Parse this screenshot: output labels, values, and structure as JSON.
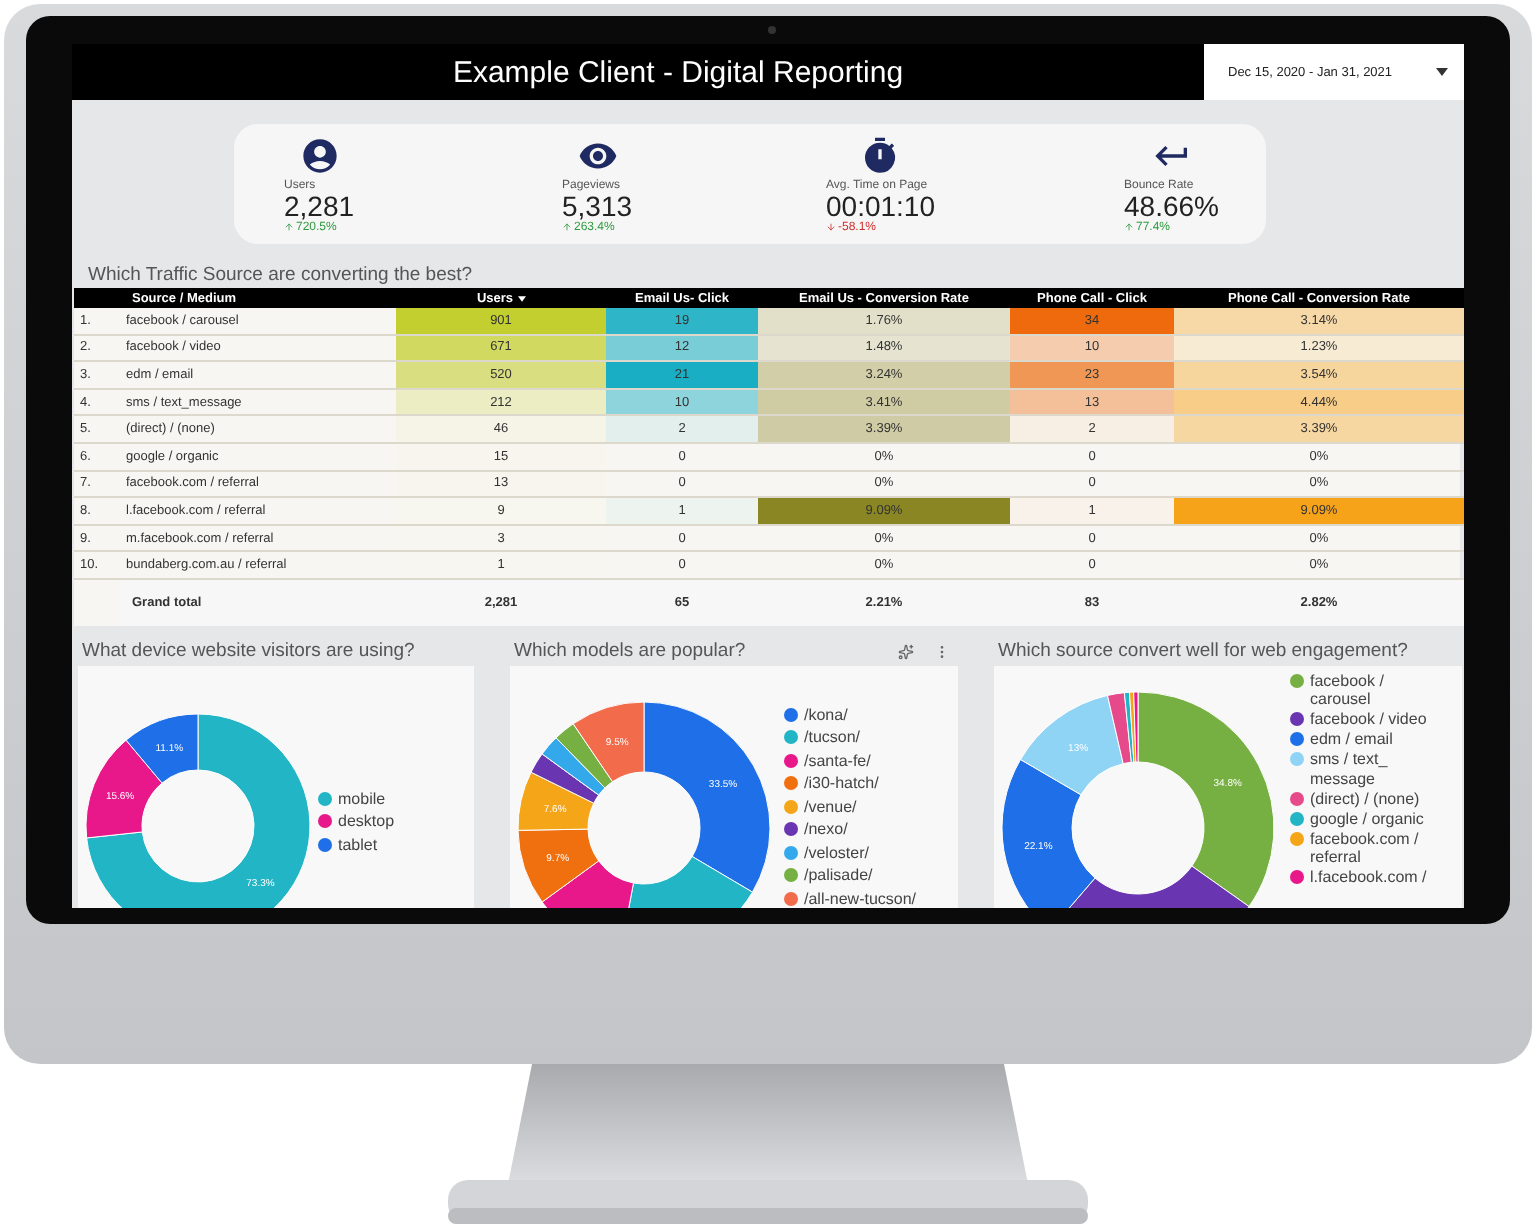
{
  "header": {
    "title": "Example Client - Digital Reporting",
    "date_range": "Dec 15, 2020 - Jan 31, 2021"
  },
  "kpis": [
    {
      "kind": "users",
      "label": "Users",
      "value": "2,281",
      "delta": "720.5%",
      "up": true
    },
    {
      "kind": "pageviews",
      "label": "Pageviews",
      "value": "5,313",
      "delta": "263.4%",
      "up": true
    },
    {
      "kind": "time",
      "label": "Avg. Time on Page",
      "value": "00:01:10",
      "delta": "-58.1%",
      "up": false
    },
    {
      "kind": "bounce",
      "label": "Bounce Rate",
      "value": "48.66%",
      "delta": "77.4%",
      "up": true
    }
  ],
  "table": {
    "title": "Which Traffic Source are converting the best?",
    "columns": [
      {
        "label": "Source / Medium",
        "sorted": false
      },
      {
        "label": "Users",
        "sorted": true,
        "color": "#c3cf2e"
      },
      {
        "label": "Email Us- Click",
        "sorted": false,
        "color": "#1aaec4"
      },
      {
        "label": "Email Us - Conversion Rate",
        "sorted": false,
        "color": "#8a8624"
      },
      {
        "label": "Phone Call - Click",
        "sorted": false,
        "color": "#ee6a0c"
      },
      {
        "label": "Phone Call - Conversion Rate",
        "sorted": false,
        "color": "#f6a31a"
      }
    ],
    "rows": [
      {
        "index": "1.",
        "cells": [
          "facebook / carousel",
          "901",
          "19",
          "1.76%",
          "34",
          "3.14%"
        ]
      },
      {
        "index": "2.",
        "cells": [
          "facebook / video",
          "671",
          "12",
          "1.48%",
          "10",
          "1.23%"
        ]
      },
      {
        "index": "3.",
        "cells": [
          "edm / email",
          "520",
          "21",
          "3.24%",
          "23",
          "3.54%"
        ]
      },
      {
        "index": "4.",
        "cells": [
          "sms / text_message",
          "212",
          "10",
          "3.41%",
          "13",
          "4.44%"
        ]
      },
      {
        "index": "5.",
        "cells": [
          "(direct) / (none)",
          "46",
          "2",
          "3.39%",
          "2",
          "3.39%"
        ]
      },
      {
        "index": "6.",
        "cells": [
          "google / organic",
          "15",
          "0",
          "0%",
          "0",
          "0%"
        ]
      },
      {
        "index": "7.",
        "cells": [
          "facebook.com / referral",
          "13",
          "0",
          "0%",
          "0",
          "0%"
        ]
      },
      {
        "index": "8.",
        "cells": [
          "l.facebook.com / referral",
          "9",
          "1",
          "9.09%",
          "1",
          "9.09%"
        ]
      },
      {
        "index": "9.",
        "cells": [
          "m.facebook.com / referral",
          "3",
          "0",
          "0%",
          "0",
          "0%"
        ]
      },
      {
        "index": "10.",
        "cells": [
          "bundaberg.com.au / referral",
          "1",
          "0",
          "0%",
          "0",
          "0%"
        ]
      }
    ],
    "total": {
      "label": "Grand total",
      "cells": [
        "2,281",
        "65",
        "2.21%",
        "83",
        "2.82%"
      ]
    }
  },
  "charts": [
    {
      "title": "What device website visitors are using?",
      "menu": false,
      "chart_data": {
        "type": "donut",
        "legend": "right",
        "categories": [
          "mobile",
          "desktop",
          "tablet"
        ],
        "colors": [
          "#22b5c6",
          "#e8178a",
          "#1e6fe8"
        ],
        "values": [
          73.3,
          15.6,
          11.1
        ],
        "value_labels": [
          "73.3%",
          "15.6%",
          "11.1%"
        ]
      }
    },
    {
      "title": "Which models are popular?",
      "menu": true,
      "chart_data": {
        "type": "donut",
        "legend": "right",
        "categories": [
          "/kona/",
          "/tucson/",
          "/santa-fe/",
          "/i30-hatch/",
          "/venue/",
          "/nexo/",
          "/veloster/",
          "/palisade/",
          "/all-new-tucson/"
        ],
        "colors": [
          "#1e6fe8",
          "#22b5c6",
          "#e8178a",
          "#f07010",
          "#f5a518",
          "#6a35b0",
          "#33a9ec",
          "#76b043",
          "#f26b4a"
        ],
        "values": [
          33.5,
          19.5,
          12,
          9.7,
          7.6,
          2.7,
          2.7,
          2.8,
          9.5
        ],
        "value_labels": [
          "33.5%",
          null,
          null,
          "9.7%",
          "7.6%",
          null,
          null,
          null,
          "9.5%"
        ]
      }
    },
    {
      "title": "Which source convert well  for web engagement?",
      "menu": false,
      "chart_data": {
        "type": "donut",
        "legend": "right",
        "categories": [
          "facebook / carousel",
          "facebook / video",
          "edm / email",
          "sms / text_ message",
          "(direct) / (none)",
          "google / organic",
          "facebook.com / referral",
          "l.facebook.com /"
        ],
        "colors": [
          "#76b043",
          "#6a35b0",
          "#1e6fe8",
          "#8fd3f5",
          "#e64a8a",
          "#22b5c6",
          "#f5a518",
          "#e8178a"
        ],
        "values": [
          34.8,
          26.5,
          22.1,
          13,
          2,
          0.6,
          0.5,
          0.5
        ],
        "value_labels": [
          "34.8%",
          null,
          "22.1%",
          "13%",
          null,
          null,
          null,
          null
        ]
      }
    }
  ]
}
